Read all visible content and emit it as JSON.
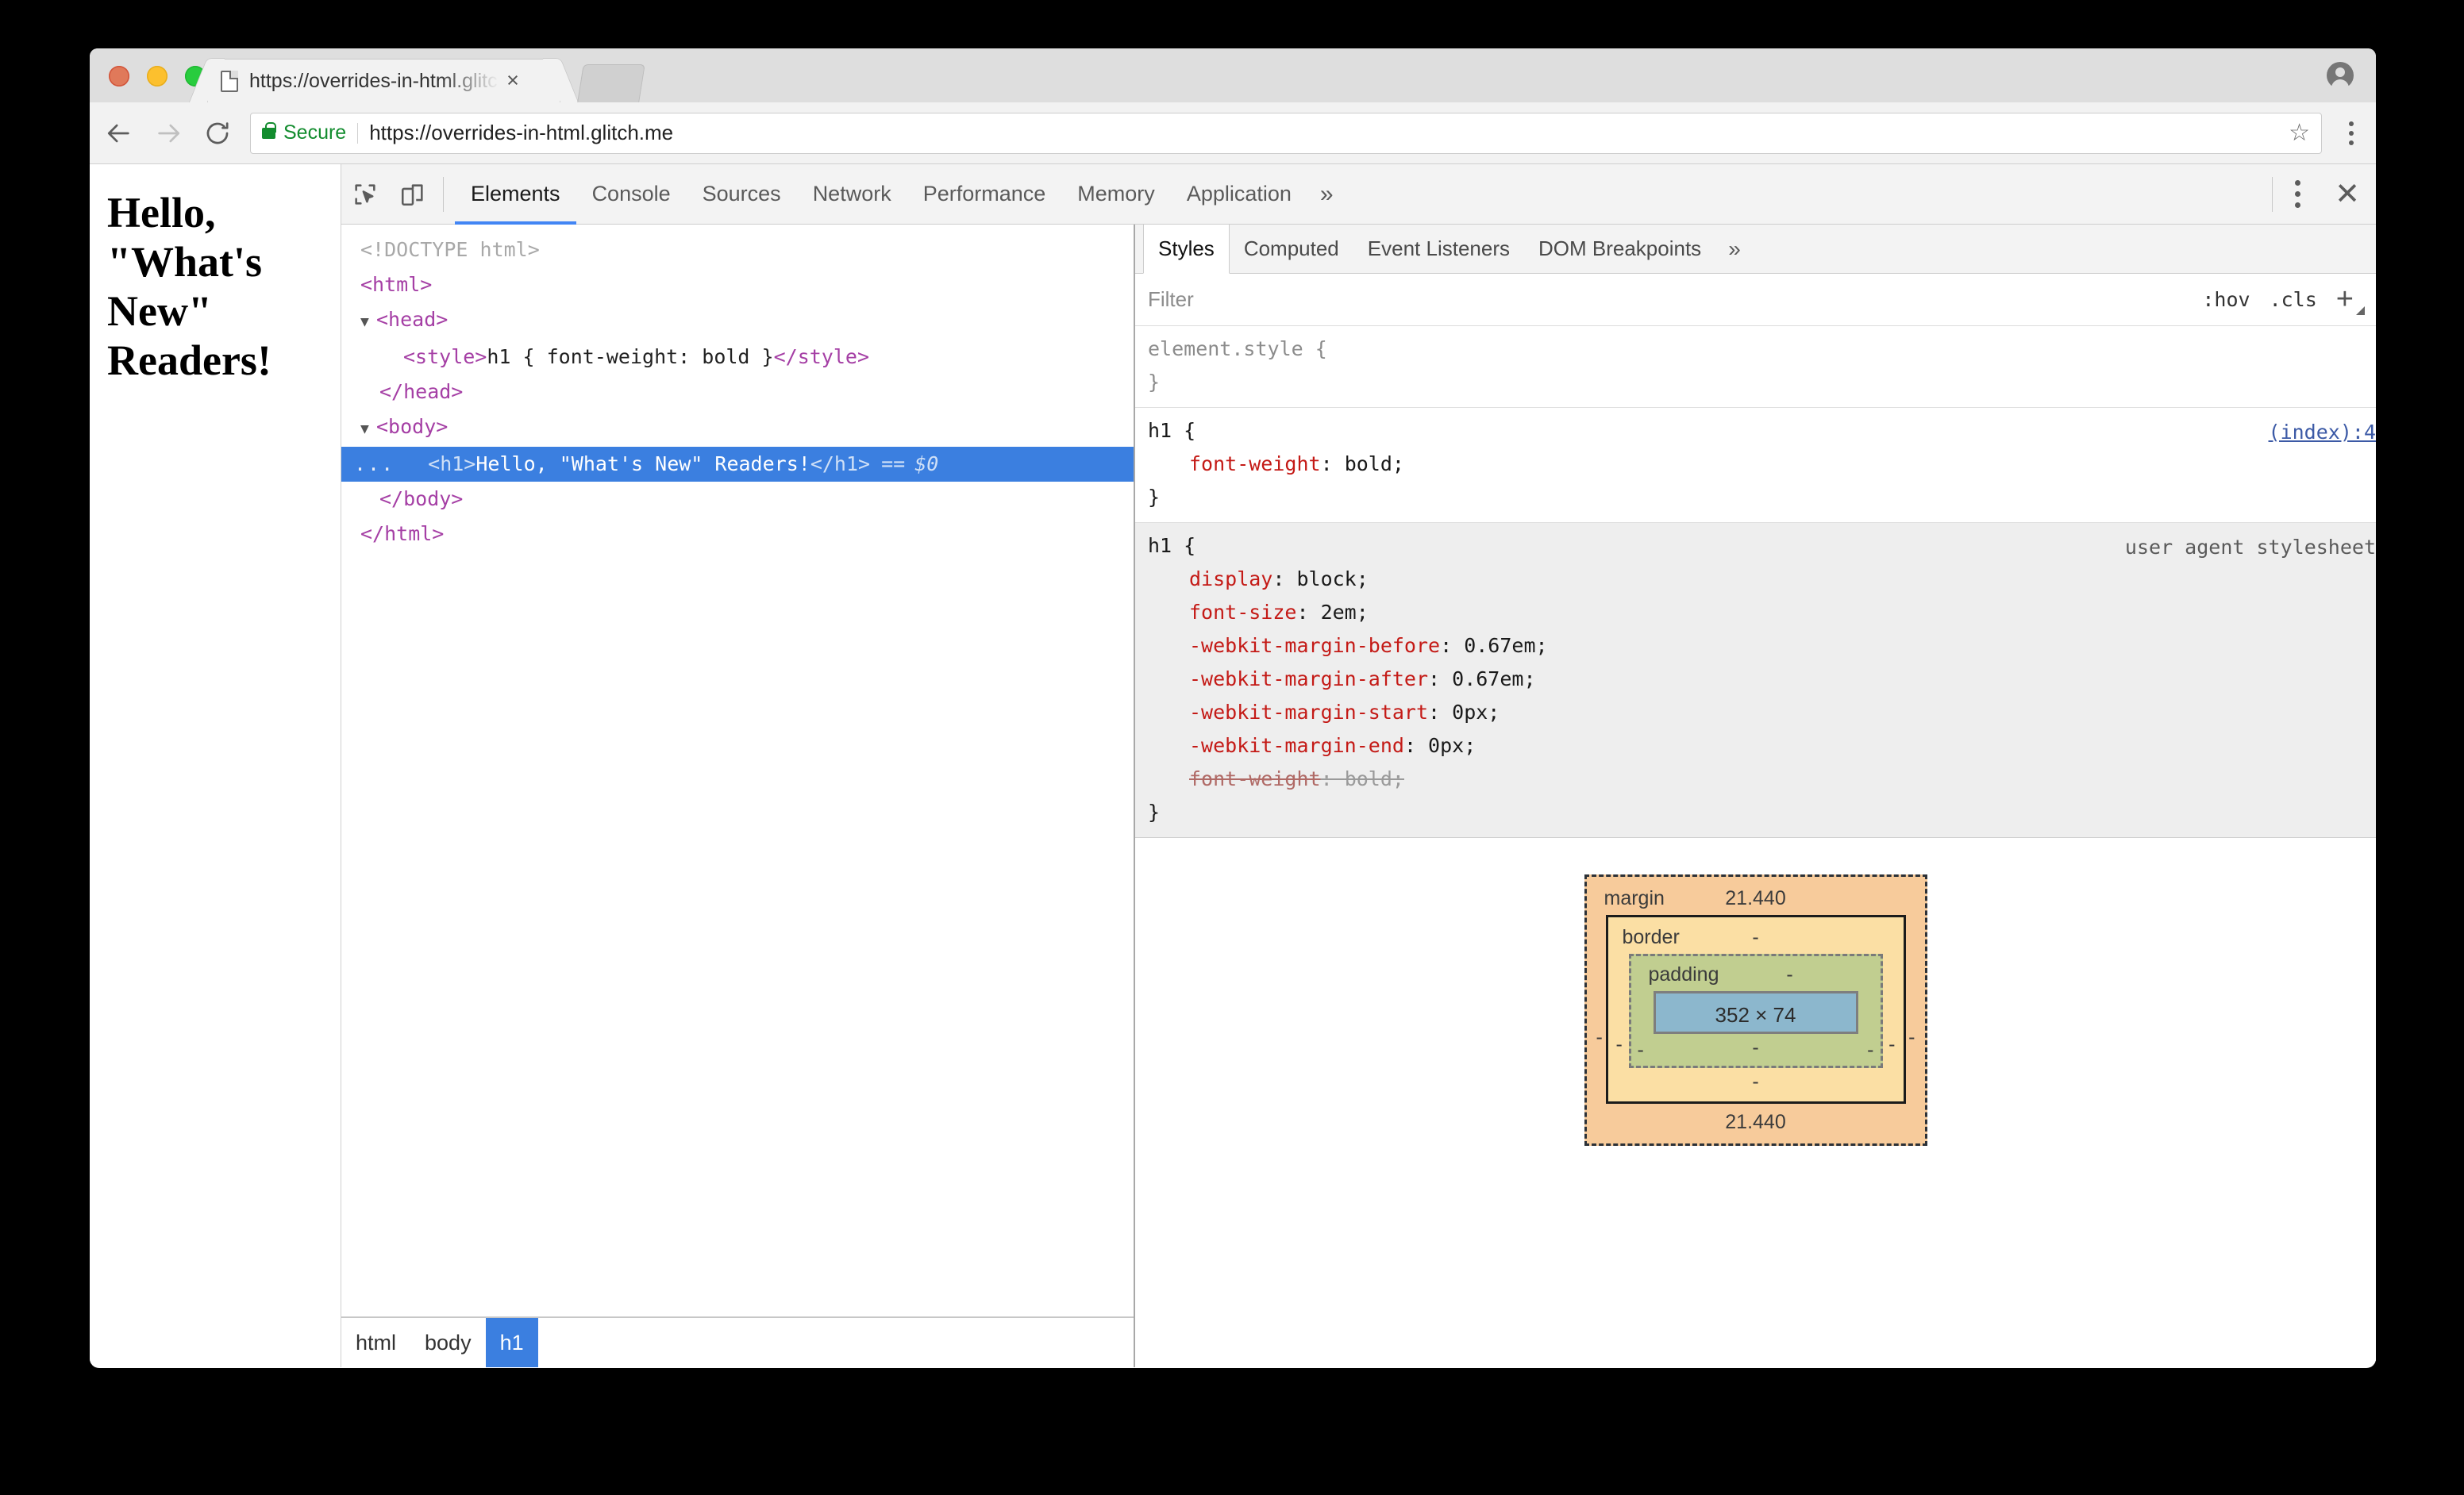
{
  "browser": {
    "tab": {
      "title": "https://overrides-in-html.glitch",
      "favicon": "document-icon",
      "close": "×"
    },
    "toolbar": {
      "back": "back-arrow-icon",
      "forward": "forward-arrow-icon",
      "reload": "reload-icon",
      "secure_label": "Secure",
      "url": "https://overrides-in-html.glitch.me",
      "star": "☆",
      "menu": "three-dot-menu-icon"
    },
    "profile": "profile-avatar-icon"
  },
  "page": {
    "heading": "Hello, \"What's New\" Readers!"
  },
  "devtools": {
    "toolbar": {
      "inspect": "inspect-element-icon",
      "device_toggle": "device-toolbar-icon",
      "tabs": [
        {
          "label": "Elements",
          "active": true
        },
        {
          "label": "Console",
          "active": false
        },
        {
          "label": "Sources",
          "active": false
        },
        {
          "label": "Network",
          "active": false
        },
        {
          "label": "Performance",
          "active": false
        },
        {
          "label": "Memory",
          "active": false
        },
        {
          "label": "Application",
          "active": false
        }
      ],
      "more": "»",
      "menu": "three-dot-menu-icon",
      "close": "✕"
    },
    "dom": {
      "lines": [
        {
          "kind": "doctype",
          "text": "<!DOCTYPE html>"
        },
        {
          "kind": "tag",
          "text": "<html>"
        },
        {
          "kind": "tag",
          "triangle": "▼",
          "text": "<head>"
        },
        {
          "kind": "style",
          "open": "<style>",
          "css": "h1 { font-weight: bold }",
          "close": "</style>"
        },
        {
          "kind": "tag",
          "text": "</head>"
        },
        {
          "kind": "tag",
          "triangle": "▼",
          "text": "<body>"
        },
        {
          "kind": "selected",
          "ellipsis": "...",
          "open": "<h1>",
          "text": "Hello, \"What's New\" Readers!",
          "close": "</h1>",
          "eq": "==",
          "dollar": "$0"
        },
        {
          "kind": "tag",
          "text": "</body>"
        },
        {
          "kind": "tag",
          "text": "</html>"
        }
      ]
    },
    "breadcrumb": [
      {
        "label": "html",
        "active": false
      },
      {
        "label": "body",
        "active": false
      },
      {
        "label": "h1",
        "active": true
      }
    ],
    "styles": {
      "tabs": [
        {
          "label": "Styles",
          "active": true
        },
        {
          "label": "Computed",
          "active": false
        },
        {
          "label": "Event Listeners",
          "active": false
        },
        {
          "label": "DOM Breakpoints",
          "active": false
        }
      ],
      "more": "»",
      "filter_placeholder": "Filter",
      "hov": ":hov",
      "cls": ".cls",
      "new_rule": "+",
      "rules": [
        {
          "selector": "element.style",
          "dim": true,
          "origin": "",
          "origin_link": false,
          "declarations": []
        },
        {
          "selector": "h1",
          "dim": false,
          "origin": "(index):4",
          "origin_link": true,
          "declarations": [
            {
              "prop": "font-weight",
              "value": "bold",
              "overridden": false
            }
          ]
        },
        {
          "selector": "h1",
          "dim": false,
          "ua": true,
          "origin": "user agent stylesheet",
          "origin_link": false,
          "declarations": [
            {
              "prop": "display",
              "value": "block",
              "overridden": false
            },
            {
              "prop": "font-size",
              "value": "2em",
              "overridden": false
            },
            {
              "prop": "-webkit-margin-before",
              "value": "0.67em",
              "overridden": false
            },
            {
              "prop": "-webkit-margin-after",
              "value": "0.67em",
              "overridden": false
            },
            {
              "prop": "-webkit-margin-start",
              "value": "0px",
              "overridden": false
            },
            {
              "prop": "-webkit-margin-end",
              "value": "0px",
              "overridden": false
            },
            {
              "prop": "font-weight",
              "value": "bold",
              "overridden": true
            }
          ]
        }
      ],
      "box_model": {
        "margin_label": "margin",
        "margin_top": "21.440",
        "margin_bottom": "21.440",
        "margin_left": "-",
        "margin_right": "-",
        "border_label": "border",
        "border_top": "-",
        "border_bottom": "-",
        "border_left": "-",
        "border_right": "-",
        "padding_label": "padding",
        "padding_top": "-",
        "padding_bottom": "-",
        "padding_left": "-",
        "padding_right": "-",
        "content": "352 × 74",
        "colors": {
          "margin": "#f7cb9b",
          "border": "#fbdfa4",
          "padding": "#c1ce90",
          "content": "#8cb7cd"
        }
      }
    }
  }
}
